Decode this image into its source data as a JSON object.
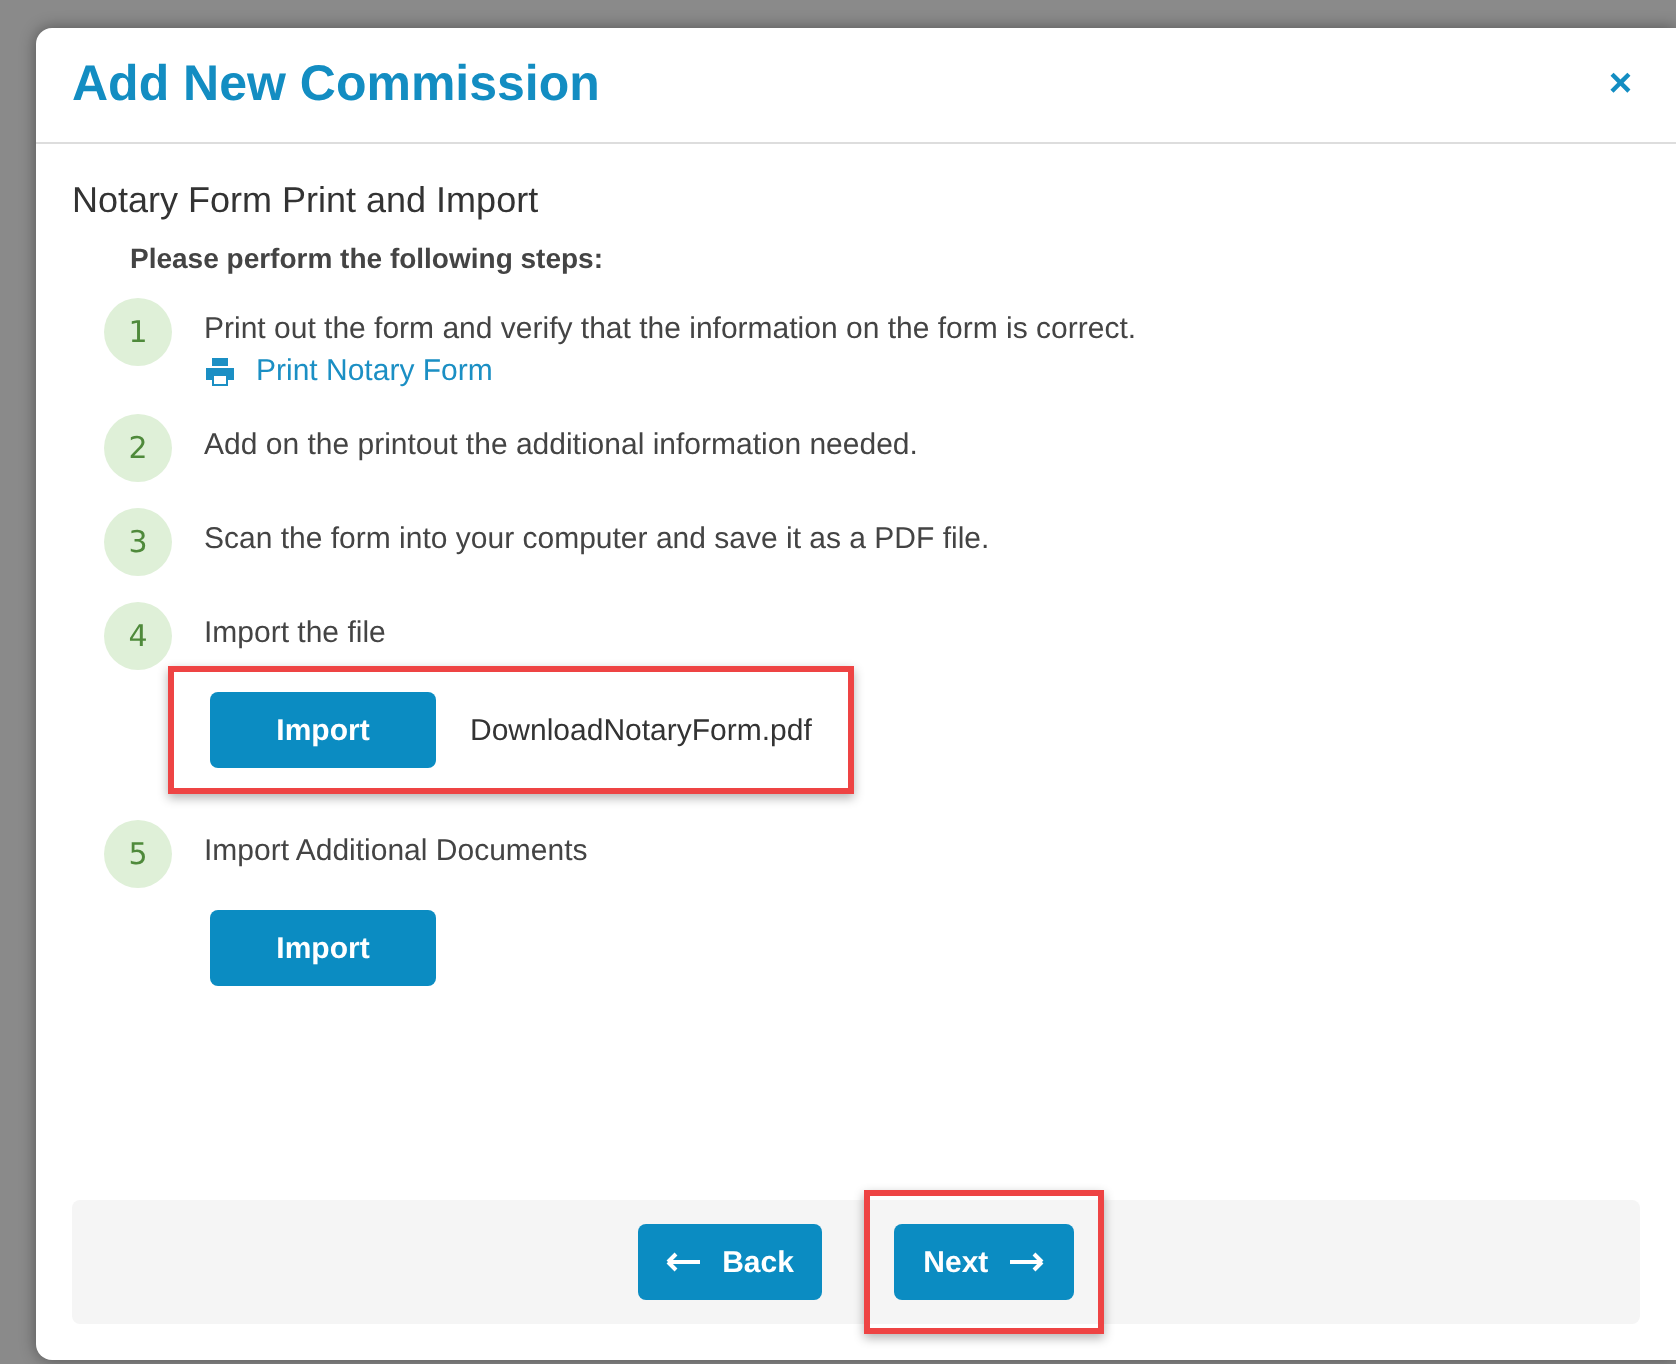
{
  "dialog": {
    "title": "Add New Commission",
    "close": "×"
  },
  "section": {
    "heading": "Notary Form Print and Import",
    "intro": "Please perform the following steps:"
  },
  "steps": [
    {
      "number": "1",
      "text": "Print out the form and verify that the information on the form is correct.",
      "link": "Print Notary Form"
    },
    {
      "number": "2",
      "text": "Add on the printout the additional information needed."
    },
    {
      "number": "3",
      "text": "Scan the form into your computer and save it as a PDF file."
    },
    {
      "number": "4",
      "text": "Import the file",
      "import": {
        "label": "Import",
        "file": "DownloadNotaryForm.pdf",
        "highlighted": true
      }
    },
    {
      "number": "5",
      "text": "Import Additional Documents",
      "import": {
        "label": "Import",
        "highlighted": false
      }
    }
  ],
  "footer": {
    "buttons": [
      {
        "label": "Back",
        "kind": "back",
        "highlighted": false
      },
      {
        "label": "Next",
        "kind": "next",
        "highlighted": true
      }
    ]
  }
}
